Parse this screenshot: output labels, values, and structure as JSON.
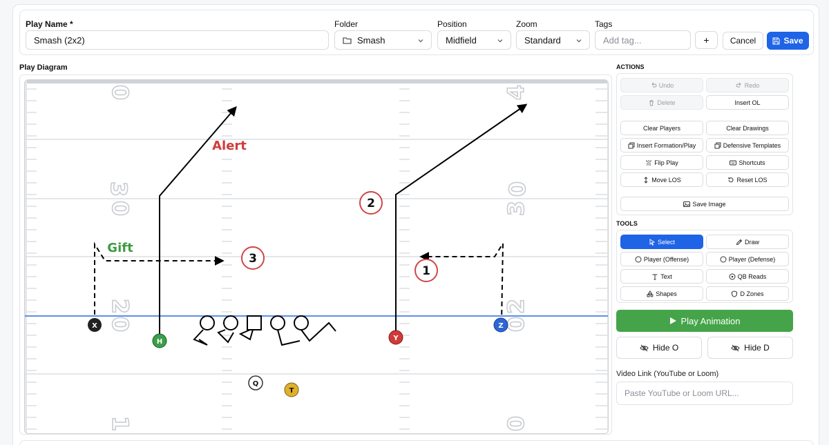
{
  "header": {
    "play_name_label": "Play Name *",
    "play_name_value": "Smash (2x2)",
    "folder_label": "Folder",
    "folder_value": "Smash",
    "position_label": "Position",
    "position_value": "Midfield",
    "zoom_label": "Zoom",
    "zoom_value": "Standard",
    "tags_label": "Tags",
    "tags_placeholder": "Add tag...",
    "add_tag_label": "+",
    "cancel_label": "Cancel",
    "save_label": "Save"
  },
  "diagram": {
    "title": "Play Diagram",
    "yard_numbers": [
      "0",
      "0",
      "4",
      "0",
      "3",
      "0",
      "0",
      "3",
      "0",
      "2",
      "0",
      "2",
      "1",
      "0"
    ],
    "labels": {
      "alert": "Alert",
      "gift": "Gift",
      "read_1": "1",
      "read_2": "2",
      "read_3": "3"
    },
    "players": {
      "x": "X",
      "h": "H",
      "y": "Y",
      "z": "Z",
      "q": "Q",
      "t": "T"
    },
    "colors": {
      "alert": "#d23b3b",
      "gift": "#3f9b43",
      "los": "#5b8fe8",
      "x": "#222222",
      "h": "#3d9e49",
      "y": "#d23a3a",
      "z": "#2f66d6",
      "t": "#e0b02c"
    }
  },
  "actions": {
    "title": "ACTIONS",
    "undo": "Undo",
    "redo": "Redo",
    "delete": "Delete",
    "insert_ol": "Insert OL",
    "clear_players": "Clear Players",
    "clear_drawings": "Clear Drawings",
    "insert_formation": "Insert Formation/Play",
    "defensive_templates": "Defensive Templates",
    "flip_play": "Flip Play",
    "shortcuts": "Shortcuts",
    "move_los": "Move LOS",
    "reset_los": "Reset LOS",
    "save_image": "Save Image"
  },
  "tools": {
    "title": "TOOLS",
    "select": "Select",
    "draw": "Draw",
    "player_offense": "Player (Offense)",
    "player_defense": "Player (Defense)",
    "text": "Text",
    "qb_reads": "QB Reads",
    "shapes": "Shapes",
    "d_zones": "D Zones"
  },
  "play_animation": "Play Animation",
  "hide_o": "Hide O",
  "hide_d": "Hide D",
  "video": {
    "label": "Video Link (YouTube or Loom)",
    "placeholder": "Paste YouTube or Loom URL..."
  }
}
